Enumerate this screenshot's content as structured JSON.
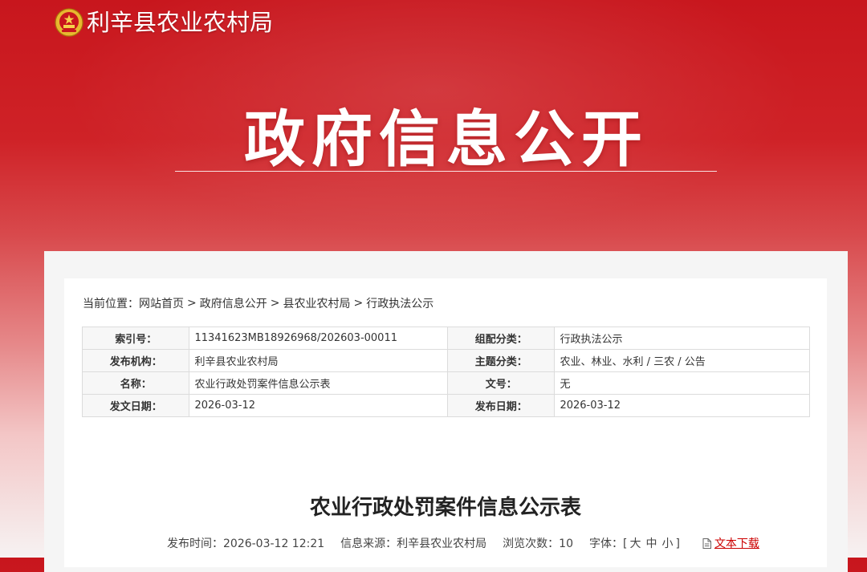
{
  "header": {
    "site_name": "利辛县农业农村局",
    "banner_title": "政府信息公开",
    "emblem_icon": "national-emblem-icon"
  },
  "breadcrumb": {
    "prefix": "当前位置：",
    "items": [
      "网站首页",
      "政府信息公开",
      "县农业农村局",
      "行政执法公示"
    ],
    "separator": ">"
  },
  "meta_table": {
    "rows": [
      {
        "k1": "索引号：",
        "v1": "11341623MB18926968/202603-00011",
        "k2": "组配分类：",
        "v2": "行政执法公示"
      },
      {
        "k1": "发布机构：",
        "v1": "利辛县农业农村局",
        "k2": "主题分类：",
        "v2": "农业、林业、水利 / 三农 / 公告"
      },
      {
        "k1": "名称：",
        "v1": "农业行政处罚案件信息公示表",
        "k2": "文号：",
        "v2": "无"
      },
      {
        "k1": "发文日期：",
        "v1": "2026-03-12",
        "k2": "发布日期：",
        "v2": "2026-03-12"
      }
    ]
  },
  "article": {
    "title": "农业行政处罚案件信息公示表",
    "publish_time": "发布时间：2026-03-12 12:21",
    "source": "信息来源：利辛县农业农村局",
    "views_label": "浏览次数：",
    "views": "10",
    "font_size_label": "字体：[",
    "font_large": "大",
    "font_medium": "中",
    "font_small": "小",
    "font_size_end": "]",
    "download": "文本下载"
  },
  "colors": {
    "banner_red": "#c8161d",
    "link_red": "#cc0000"
  }
}
